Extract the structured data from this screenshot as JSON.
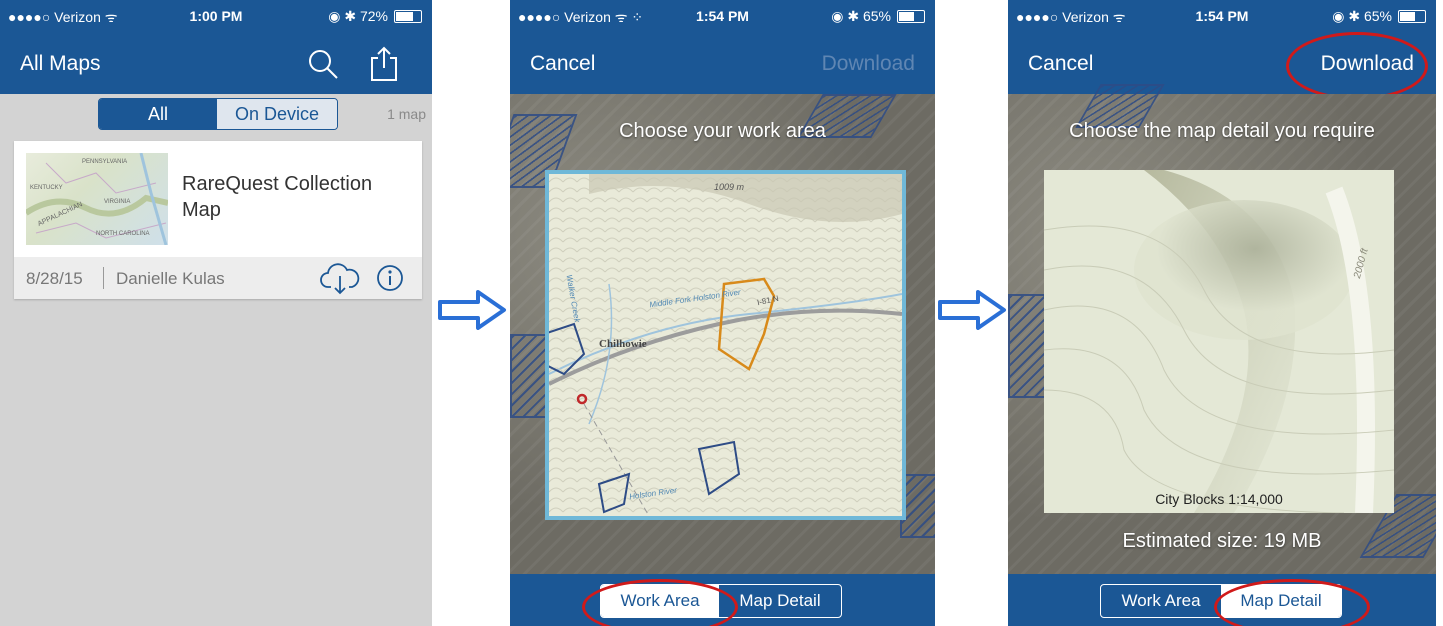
{
  "screen1": {
    "status": {
      "carrier": "●●●●○ Verizon ᯤ",
      "time": "1:00 PM",
      "battery": "◉ ✱ 72%",
      "battery_level": 0.72
    },
    "title": "All Maps",
    "segment": {
      "all": "All",
      "on_device": "On Device"
    },
    "map_count": "1 map",
    "card": {
      "title": "RareQuest Collection Map",
      "date": "8/28/15",
      "author": "Danielle Kulas"
    },
    "thumbnail_labels": {
      "region": "APPALACHIAN",
      "state1": "KENTUCKY",
      "state2": "VIRGINIA",
      "state3": "NORTH CAROLINA",
      "state4": "PENNSYLVANIA"
    }
  },
  "screen2": {
    "status": {
      "carrier": "●●●●○ Verizon ᯤ ⁘",
      "time": "1:54 PM",
      "battery": "◉ ✱ 65%",
      "battery_level": 0.65
    },
    "cancel": "Cancel",
    "download": "Download",
    "instruction": "Choose your work area",
    "map_labels": {
      "elevation": "1009 m",
      "town": "Chilhowie",
      "river": "Middle Fork Holston River",
      "creek": "Walker Creek",
      "highway": "I-81 N",
      "river2": "Holston River"
    },
    "tabs": {
      "work_area": "Work Area",
      "map_detail": "Map Detail"
    }
  },
  "screen3": {
    "status": {
      "carrier": "●●●●○ Verizon ᯤ",
      "time": "1:54 PM",
      "battery": "◉ ✱ 65%",
      "battery_level": 0.65
    },
    "cancel": "Cancel",
    "download": "Download",
    "instruction": "Choose the map detail you require",
    "contour_label": "2000 ft",
    "scale_label": "City Blocks 1:14,000",
    "estimated_size": "Estimated size: 19 MB",
    "tabs": {
      "work_area": "Work Area",
      "map_detail": "Map Detail"
    }
  },
  "icons": {
    "search": "search-icon",
    "share": "share-icon",
    "cloud_download": "cloud-download-icon",
    "info": "info-icon",
    "arrow": "right-arrow-icon"
  },
  "colors": {
    "nav_blue": "#1b5795",
    "highlight_red": "#d01a1a",
    "arrow_blue": "#2a6fd6",
    "work_area_border": "#6fb8d8",
    "selection": "#d88a1a"
  }
}
